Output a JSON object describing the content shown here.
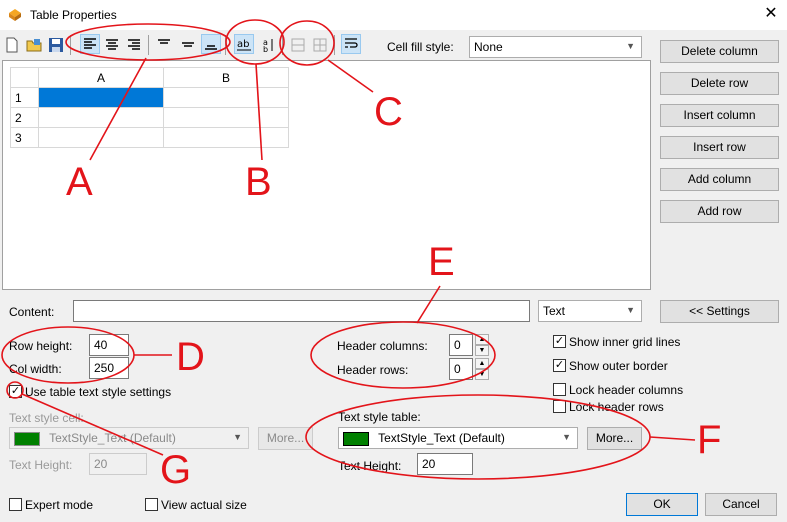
{
  "window": {
    "title": "Table Properties",
    "close_glyph": "✕"
  },
  "toolbar": {
    "icons": [
      "new-icon",
      "open-icon",
      "save-icon",
      "align-left-icon",
      "align-center-icon",
      "align-right-icon",
      "align-top-icon",
      "align-middle-icon",
      "align-bottom-icon",
      "text-horizontal-icon",
      "text-vertical-icon",
      "merge-cells-icon",
      "split-cells-icon",
      "wrap-text-icon"
    ],
    "cell_fill_label": "Cell fill style:",
    "cell_fill_value": "None"
  },
  "side_buttons": [
    "Delete column",
    "Delete row",
    "Insert column",
    "Insert row",
    "Add column",
    "Add row"
  ],
  "grid": {
    "columns": [
      "A",
      "B"
    ],
    "rows": [
      "1",
      "2",
      "3"
    ]
  },
  "content": {
    "label": "Content:",
    "value": "",
    "type_value": "Text",
    "settings_button": "<< Settings"
  },
  "dimensions": {
    "row_height_label": "Row height:",
    "row_height": "40",
    "col_width_label": "Col width:",
    "col_width": "250"
  },
  "header": {
    "columns_label": "Header columns:",
    "columns": "0",
    "rows_label": "Header rows:",
    "rows": "0"
  },
  "options": [
    {
      "label": "Show inner grid lines",
      "checked": true
    },
    {
      "label": "Show outer border",
      "checked": true
    },
    {
      "label": "Lock header columns",
      "checked": false
    },
    {
      "label": "Lock header rows",
      "checked": false
    }
  ],
  "use_table_style": {
    "label": "Use table text style settings",
    "checked": true
  },
  "cell_style": {
    "label": "Text style cell:",
    "value": "TextStyle_Text (Default)",
    "more": "More...",
    "height_label": "Text Height:",
    "height": "20"
  },
  "table_style": {
    "label": "Text style table:",
    "value": "TextStyle_Text (Default)",
    "more": "More...",
    "height_label": "Text Height:",
    "height": "20"
  },
  "footer": {
    "expert_mode": "Expert mode",
    "view_actual": "View actual size",
    "ok": "OK",
    "cancel": "Cancel"
  },
  "annotations": [
    "A",
    "B",
    "C",
    "D",
    "E",
    "F",
    "G"
  ],
  "colors": {
    "accent": "#0078d7",
    "annotation": "#e3141a",
    "style_swatch": "#008000"
  }
}
